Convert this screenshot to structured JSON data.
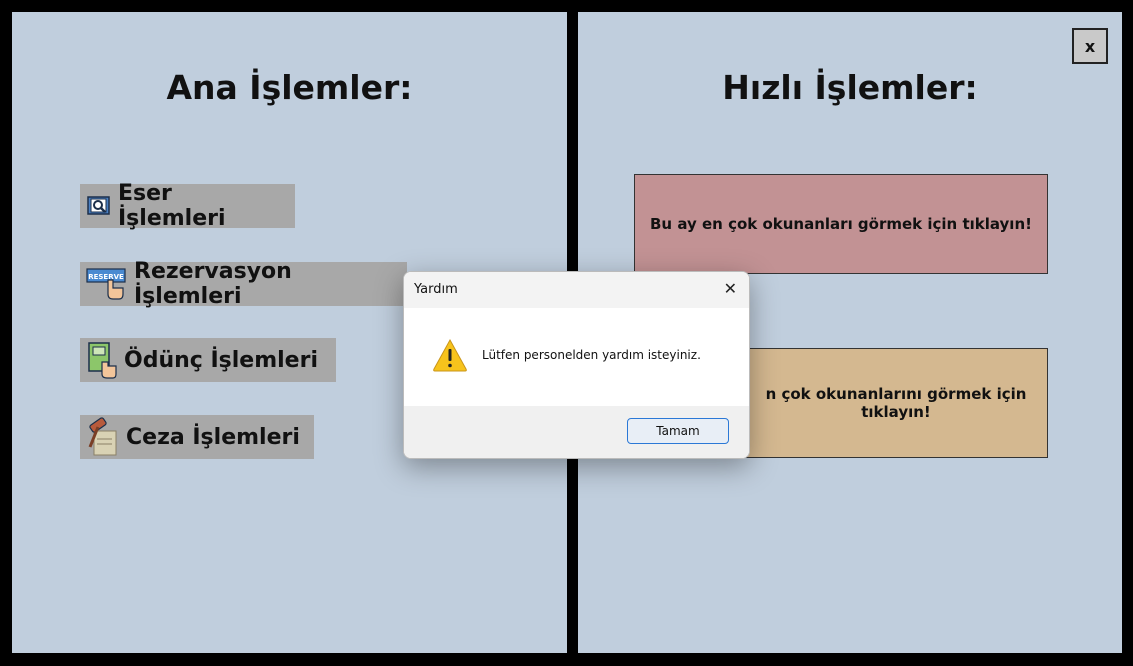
{
  "left": {
    "title": "Ana İşlemler:",
    "items": [
      {
        "label": "Eser İşlemleri",
        "icon": "book-search-icon"
      },
      {
        "label": "Rezervasyon İşlemleri",
        "icon": "reserve-hand-icon",
        "icon_text": "RESERVE"
      },
      {
        "label": "Ödünç İşlemleri",
        "icon": "book-hand-icon"
      },
      {
        "label": "Ceza İşlemleri",
        "icon": "gavel-icon"
      }
    ]
  },
  "right": {
    "title": "Hızlı İşlemler:",
    "close_label": "x",
    "quick": [
      {
        "label": "Bu ay en çok okunanları görmek için tıklayın!",
        "color": "#c29294"
      },
      {
        "label": "n çok okunanlarını görmek için tıklayın!",
        "color": "#d4b890"
      }
    ]
  },
  "dialog": {
    "title": "Yardım",
    "close": "✕",
    "message": "Lütfen personelden yardım isteyiniz.",
    "ok": "Tamam",
    "icon": "warning-icon"
  }
}
